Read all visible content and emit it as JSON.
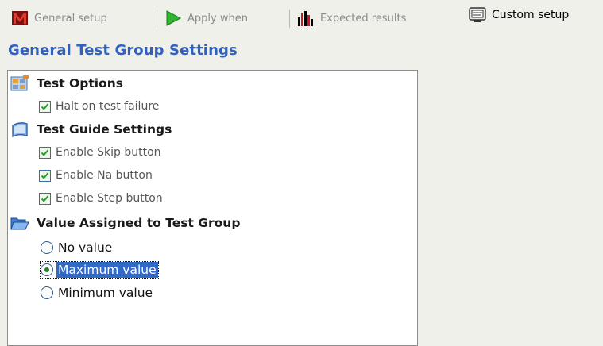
{
  "tabs": [
    {
      "label": "General setup",
      "icon": "m-logo-icon",
      "active": false
    },
    {
      "label": "Apply when",
      "icon": "play-arrow-icon",
      "active": false
    },
    {
      "label": "Expected results",
      "icon": "bar-chart-icon",
      "active": false
    },
    {
      "label": "Custom setup",
      "icon": "monitor-icon",
      "active": true
    }
  ],
  "section_title": "General Test Group Settings",
  "groups": {
    "test_options": {
      "header": "Test Options",
      "icon": "options-icon",
      "items": [
        {
          "label": "Halt on test failure",
          "checked": true
        }
      ]
    },
    "test_guide": {
      "header": "Test Guide Settings",
      "icon": "guide-book-icon",
      "items": [
        {
          "label": "Enable Skip button",
          "checked": true
        },
        {
          "label": "Enable Na button",
          "checked": true
        },
        {
          "label": "Enable Step button",
          "checked": true
        }
      ]
    },
    "value_assigned": {
      "header": "Value Assigned to Test Group",
      "icon": "folder-open-icon",
      "options": [
        {
          "label": "No value",
          "selected": false
        },
        {
          "label": "Maximum value",
          "selected": true
        },
        {
          "label": "Minimum value",
          "selected": false
        }
      ]
    }
  },
  "colors": {
    "title_blue": "#3060c0",
    "selection": "#3169c6",
    "background": "#f0f0ea"
  }
}
